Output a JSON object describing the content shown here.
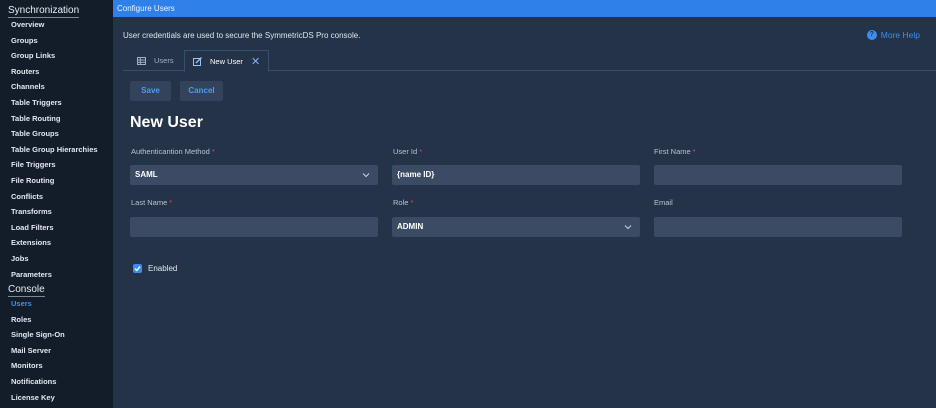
{
  "sidebar": {
    "sections": [
      {
        "title": "Synchronization",
        "items": [
          "Overview",
          "Groups",
          "Group Links",
          "Routers",
          "Channels",
          "Table Triggers",
          "Table Routing",
          "Table Groups",
          "Table Group Hierarchies",
          "File Triggers",
          "File Routing",
          "Conflicts",
          "Transforms",
          "Load Filters",
          "Extensions",
          "Jobs",
          "Parameters"
        ]
      },
      {
        "title": "Console",
        "items": [
          "Users",
          "Roles",
          "Single Sign-On",
          "Mail Server",
          "Monitors",
          "Notifications",
          "License Key"
        ],
        "active": "Users"
      }
    ]
  },
  "topbar": {
    "title": "Configure Users"
  },
  "main": {
    "description": "User credentials are used to secure the SymmetricDS Pro console.",
    "help_label": "More Help",
    "tabs": [
      {
        "label": "Users",
        "icon": "table-icon"
      },
      {
        "label": "New User",
        "icon": "edit-icon",
        "closable": true
      }
    ],
    "buttons": {
      "save": "Save",
      "cancel": "Cancel"
    },
    "heading": "New User",
    "form": {
      "auth_method": {
        "label": "Authenticantion Method",
        "required": true,
        "value": "SAML"
      },
      "user_id": {
        "label": "User Id",
        "required": true,
        "value": "{name ID}"
      },
      "first_name": {
        "label": "First Name",
        "required": true,
        "value": ""
      },
      "last_name": {
        "label": "Last Name",
        "required": true,
        "value": ""
      },
      "role": {
        "label": "Role",
        "required": true,
        "value": "ADMIN"
      },
      "email": {
        "label": "Email",
        "required": false,
        "value": ""
      },
      "enabled": {
        "label": "Enabled",
        "checked": true
      }
    }
  },
  "colors": {
    "accent": "#2f80e8",
    "required": "#e04a4a",
    "link": "#3b8ff0"
  }
}
